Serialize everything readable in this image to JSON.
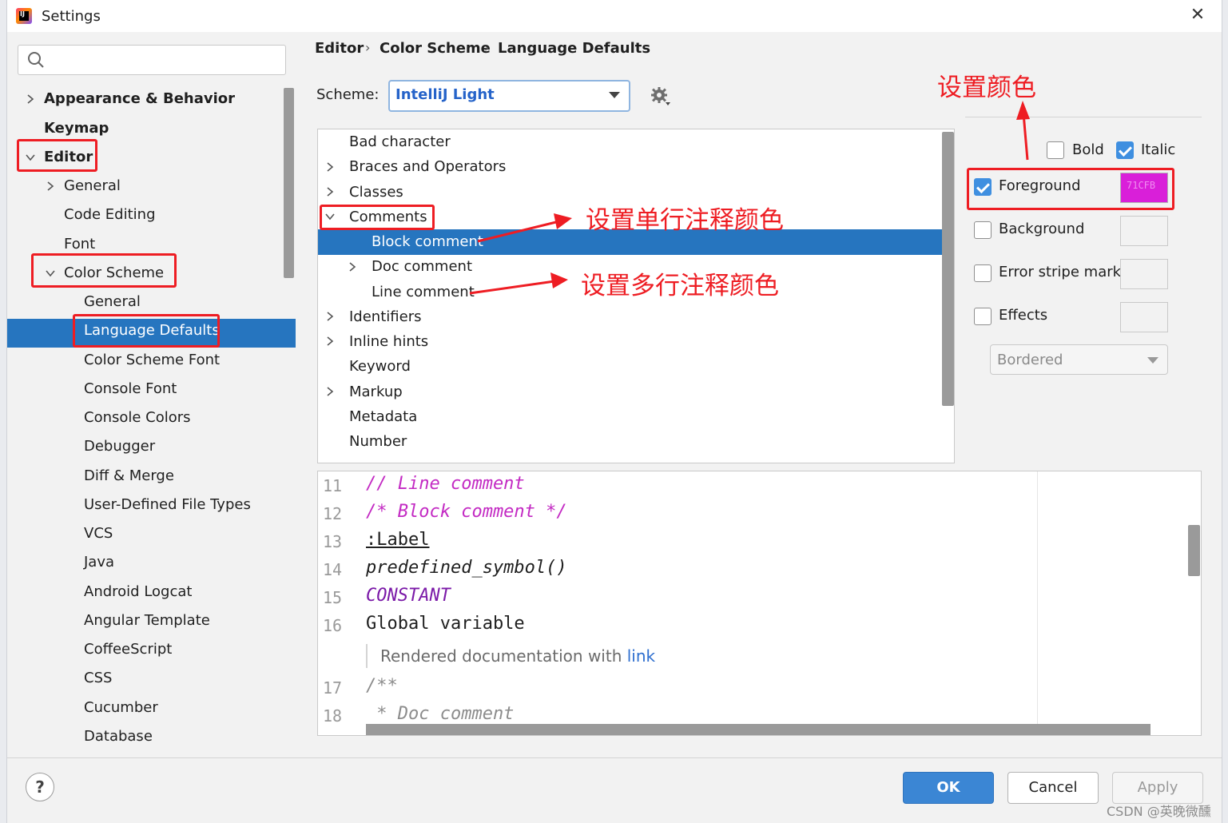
{
  "window": {
    "title": "Settings",
    "close_glyph": "✕"
  },
  "search": {
    "placeholder": ""
  },
  "sidebar": {
    "items": [
      {
        "label": "Appearance & Behavior"
      },
      {
        "label": "Keymap"
      },
      {
        "label": "Editor"
      },
      {
        "label": "General"
      },
      {
        "label": "Code Editing"
      },
      {
        "label": "Font"
      },
      {
        "label": "Color Scheme"
      },
      {
        "label": "General"
      },
      {
        "label": "Language Defaults"
      },
      {
        "label": "Color Scheme Font"
      },
      {
        "label": "Console Font"
      },
      {
        "label": "Console Colors"
      },
      {
        "label": "Debugger"
      },
      {
        "label": "Diff & Merge"
      },
      {
        "label": "User-Defined File Types"
      },
      {
        "label": "VCS"
      },
      {
        "label": "Java"
      },
      {
        "label": "Android Logcat"
      },
      {
        "label": "Angular Template"
      },
      {
        "label": "CoffeeScript"
      },
      {
        "label": "CSS"
      },
      {
        "label": "Cucumber"
      },
      {
        "label": "Database"
      }
    ]
  },
  "breadcrumb": {
    "items": [
      "Editor",
      "Color Scheme",
      "Language Defaults"
    ],
    "separator": "›"
  },
  "scheme": {
    "label": "Scheme:",
    "value": "IntelliJ Light"
  },
  "elements": {
    "items": [
      {
        "label": "Bad character"
      },
      {
        "label": "Braces and Operators"
      },
      {
        "label": "Classes"
      },
      {
        "label": "Comments"
      },
      {
        "label": "Block comment"
      },
      {
        "label": "Doc comment"
      },
      {
        "label": "Line comment"
      },
      {
        "label": "Identifiers"
      },
      {
        "label": "Inline hints"
      },
      {
        "label": "Keyword"
      },
      {
        "label": "Markup"
      },
      {
        "label": "Metadata"
      },
      {
        "label": "Number"
      }
    ]
  },
  "options": {
    "bold": {
      "label": "Bold",
      "checked": false
    },
    "italic": {
      "label": "Italic",
      "checked": true
    },
    "foreground": {
      "label": "Foreground",
      "checked": true,
      "color": "#d91fd9",
      "hex": "71CFB"
    },
    "background": {
      "label": "Background",
      "checked": false
    },
    "error_stripe": {
      "label": "Error stripe mark",
      "checked": false
    },
    "effects": {
      "label": "Effects",
      "checked": false
    },
    "effects_type": "Bordered"
  },
  "preview": {
    "line_numbers": [
      "11",
      "12",
      "13",
      "14",
      "15",
      "16",
      "17",
      "18"
    ],
    "lines": [
      "// Line comment",
      "/* Block comment */",
      ":Label",
      "predefined_symbol()",
      "CONSTANT",
      "Global variable",
      "/**",
      " * Doc comment"
    ],
    "rendered_doc_text": "Rendered documentation with ",
    "rendered_doc_link": "link"
  },
  "buttons": {
    "help": "?",
    "ok": "OK",
    "cancel": "Cancel",
    "apply": "Apply"
  },
  "annotations": {
    "set_color": "设置颜色",
    "single_line": "设置单行注释颜色",
    "multi_line": "设置多行注释颜色"
  },
  "watermark": "CSDN @英晚微醺",
  "colors": {
    "selection": "#2675bf",
    "annotation_red": "#ee1d23",
    "comment_magenta": "#c32ac3",
    "scheme_blue": "#2563c9"
  }
}
